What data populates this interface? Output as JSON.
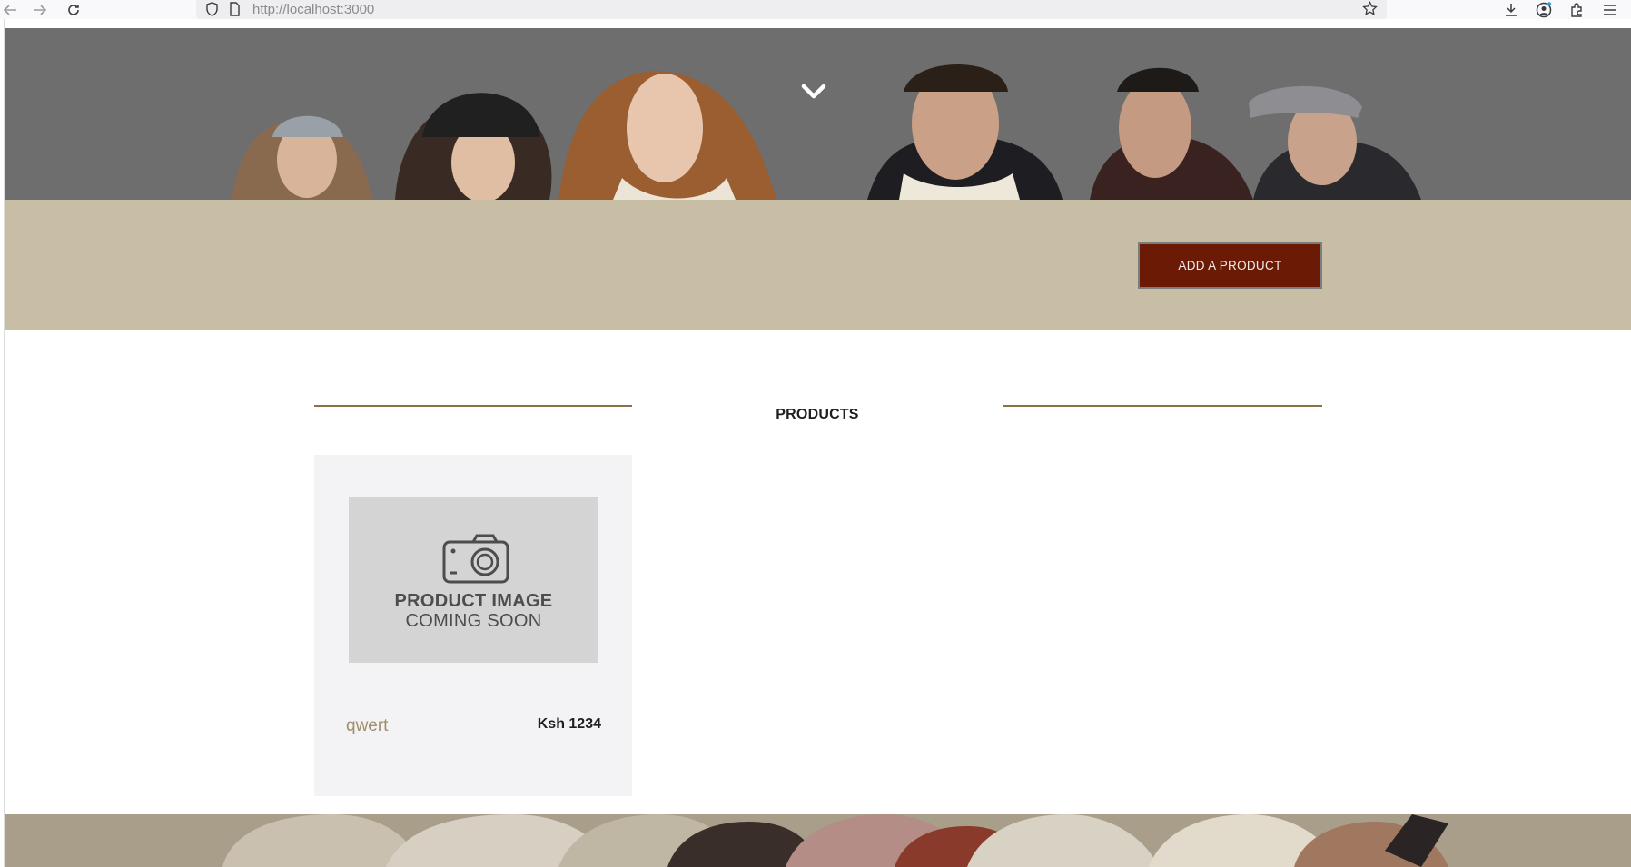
{
  "browser": {
    "url_host": "http://localhost",
    "url_port": ":3000",
    "back_icon": "back-arrow-icon",
    "forward_icon": "forward-arrow-icon",
    "reload_icon": "reload-icon"
  },
  "hero": {
    "scroll_icon": "chevron-down-icon"
  },
  "actions": {
    "add_product_label": "ADD A PRODUCT",
    "button_color": "#6b1a06",
    "band_color": "#c8bea6"
  },
  "products_section": {
    "heading": "PRODUCTS",
    "rule_color": "#8a7248",
    "items": [
      {
        "image_line1": "PRODUCT IMAGE",
        "image_line2": "COMING SOON",
        "name": "qwert",
        "price": "Ksh 1234"
      }
    ]
  }
}
